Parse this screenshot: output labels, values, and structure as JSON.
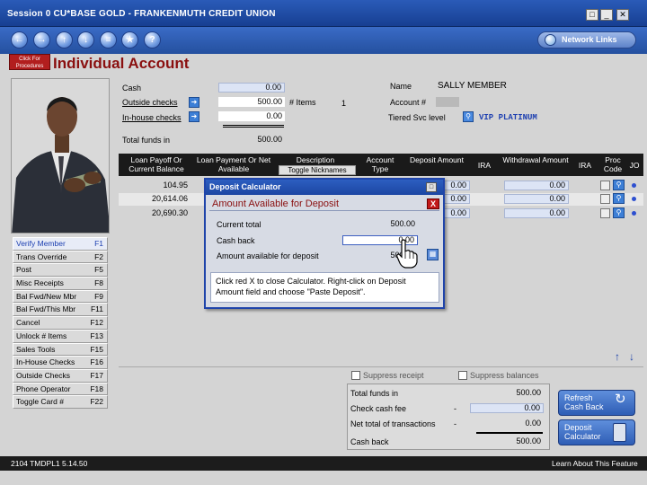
{
  "window": {
    "title": "Session 0 CU*BASE GOLD - FRANKENMUTH CREDIT UNION",
    "controls": [
      "restore",
      "minimize",
      "close"
    ]
  },
  "navbar": {
    "buttons": [
      "back-arrow",
      "forward-arrow",
      "up-arrow",
      "down-arrow",
      "menu",
      "favorite-star",
      "help"
    ],
    "network_links": "Network Links"
  },
  "page": {
    "procedures_label": "Click For Procedures",
    "title": "Individual Account"
  },
  "summary": {
    "cash_label": "Cash",
    "cash_value": "0.00",
    "outside_checks_label": "Outside checks",
    "outside_checks_value": "500.00",
    "items_label": "# Items",
    "items_value": "1",
    "inhouse_checks_label": "In-house checks",
    "inhouse_checks_value": "0.00",
    "total_funds_label": "Total funds in",
    "total_funds_value": "500.00"
  },
  "member": {
    "name_label": "Name",
    "name_value": "SALLY MEMBER",
    "account_label": "Account #",
    "tiered_label": "Tiered Svc level",
    "tiered_value": "VIP PLATINUM"
  },
  "grid": {
    "headers": [
      "Loan Payoff Or Current Balance",
      "Loan Payment Or Net Available",
      "Description",
      "Account Type",
      "Deposit Amount",
      "IRA",
      "Withdrawal Amount",
      "IRA",
      "Proc Code",
      "JO"
    ],
    "toggle_nicknames": "Toggle Nicknames",
    "rows": [
      {
        "balance": "104.95",
        "deposit": "0.00",
        "withdrawal": "0.00"
      },
      {
        "balance": "20,614.06",
        "deposit": "0.00",
        "withdrawal": "0.00"
      },
      {
        "balance": "20,690.30",
        "deposit": "0.00",
        "withdrawal": "0.00"
      }
    ]
  },
  "calculator": {
    "title": "Deposit Calculator",
    "subtitle": "Amount Available for Deposit",
    "close_label": "X",
    "current_total_label": "Current total",
    "current_total_value": "500.00",
    "cash_back_label": "Cash back",
    "cash_back_value": "0.00",
    "available_label": "Amount available for deposit",
    "available_value": "500.00",
    "note": "Click red X to close Calculator.  Right-click on Deposit Amount field and choose \"Paste Deposit\"."
  },
  "sidebar": {
    "items": [
      {
        "label": "Verify Member",
        "key": "F1"
      },
      {
        "label": "Trans Override",
        "key": "F2"
      },
      {
        "label": "Post",
        "key": "F5"
      },
      {
        "label": "Misc Receipts",
        "key": "F8"
      },
      {
        "label": "Bal Fwd/New Mbr",
        "key": "F9"
      },
      {
        "label": "Bal Fwd/This Mbr",
        "key": "F11"
      },
      {
        "label": "Cancel",
        "key": "F12"
      },
      {
        "label": "Unlock # Items",
        "key": "F13"
      },
      {
        "label": "Sales Tools",
        "key": "F15"
      },
      {
        "label": "In-House Checks",
        "key": "F16"
      },
      {
        "label": "Outside Checks",
        "key": "F17"
      },
      {
        "label": "Phone Operator",
        "key": "F18"
      },
      {
        "label": "Toggle Card #",
        "key": "F22"
      }
    ]
  },
  "options": {
    "suppress_receipt": "Suppress receipt",
    "suppress_balances": "Suppress balances"
  },
  "totals": {
    "total_funds_label": "Total funds in",
    "total_funds_value": "500.00",
    "check_cash_fee_label": "Check cash fee",
    "check_cash_fee_sign": "-",
    "check_cash_fee_value": "0.00",
    "net_total_label": "Net total of transactions",
    "net_total_sign": "-",
    "net_total_value": "0.00",
    "cash_back_label": "Cash back",
    "cash_back_value": "500.00"
  },
  "buttons": {
    "refresh_cash_back": "Refresh Cash Back",
    "deposit_calculator": "Deposit Calculator"
  },
  "statusbar": {
    "left": "2104 TMDPL1  5.14.50",
    "right": "Learn About This Feature"
  },
  "colors": {
    "title_red": "#8a0f0f",
    "accent_blue": "#1f44aa",
    "header_black": "#1a1a1a"
  }
}
